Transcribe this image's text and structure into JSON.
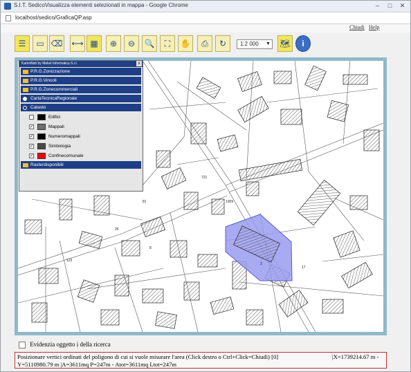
{
  "window": {
    "title": "S.I.T. SedicoVisualizza elementi selezionati in mappa - Google Chrome",
    "controls": {
      "minimize": "–",
      "maximize": "□",
      "close": "✕"
    }
  },
  "address": {
    "url": "localhost/sedico/GraficaQP.asp"
  },
  "links": {
    "close": "Chiudi",
    "help": "Help"
  },
  "toolbar": {
    "buttons": [
      {
        "icon": "legend-icon",
        "glyph": "☰"
      },
      {
        "icon": "select-rect-icon",
        "glyph": "▭"
      },
      {
        "icon": "select-clear-icon",
        "glyph": "⌫"
      },
      {
        "icon": "measure-line-icon",
        "glyph": "⟷"
      },
      {
        "icon": "measure-area-icon",
        "glyph": "▦"
      },
      {
        "icon": "zoom-in-icon",
        "glyph": "⊕"
      },
      {
        "icon": "zoom-out-icon",
        "glyph": "⊖"
      },
      {
        "icon": "zoom-window-icon",
        "glyph": "🔍"
      },
      {
        "icon": "zoom-extent-icon",
        "glyph": "⛶"
      },
      {
        "icon": "pan-hand-icon",
        "glyph": "✋"
      },
      {
        "icon": "print-icon",
        "glyph": "⎙"
      },
      {
        "icon": "refresh-icon",
        "glyph": "↻"
      }
    ],
    "scale": "1:2 000",
    "right_buttons": [
      {
        "icon": "map-overview-icon",
        "glyph": "🗺"
      },
      {
        "icon": "info-icon",
        "glyph": "i"
      }
    ]
  },
  "layer_panel": {
    "header": "KartoWeb by Mekel Informatica S.r.l.",
    "close_glyph": "x",
    "folders": [
      {
        "label": "P.R.G.Zonizzazione"
      },
      {
        "label": "P.R.G.Vincoli"
      },
      {
        "label": "P.R.G.Zonecommerciali"
      }
    ],
    "groups": [
      {
        "label": "CartaTecnicaRegionale"
      },
      {
        "label": "Catasto"
      }
    ],
    "catasto_items": [
      {
        "label": "Edifici",
        "checked": false,
        "color": "#000000"
      },
      {
        "label": "Mappali",
        "checked": true,
        "color": "#6f6f6f"
      },
      {
        "label": "Numeromappali",
        "checked": true,
        "color": "#000000"
      },
      {
        "label": "Simbologia",
        "checked": true,
        "color": "#4a4a4a"
      },
      {
        "label": "Confinecomunale",
        "checked": true,
        "color": "#ff0000"
      }
    ],
    "raster": {
      "label": "Rasterdisponibili"
    }
  },
  "search_checkbox": {
    "label": "Evidenzia oggetto i della ricerca"
  },
  "status": {
    "line1": "Posizionare vertici ordinati del poligono di cui si vuole misurare l'area (Click destro o Ctrl+Click=Chiudi) [0]",
    "line2": "Y=5110980.79 m   |A=3611mq P=247m - Atot=3611mq Ltot=247m",
    "coord_x": "|X=1739214.67 m -"
  },
  "map": {
    "selection_color": "#9a9cf0",
    "parcel_labels": [
      "721",
      "81",
      "25",
      "1009",
      "3",
      "8",
      "123",
      "17"
    ]
  }
}
